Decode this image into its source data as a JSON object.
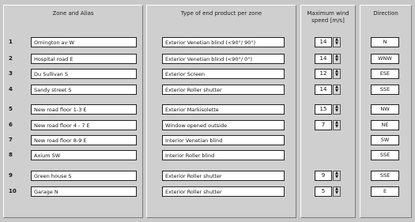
{
  "headers": {
    "zone": "Zone and Alias",
    "product": "Type of end product per zone",
    "wind_line1": "Maximum wind",
    "wind_line2": "speed [m/s]",
    "direction": "Direction"
  },
  "rows": [
    {
      "num": "1",
      "zone": "Ornington av W",
      "product": "Exterior Venetian blind (<90°/ 90°)",
      "wind": "14",
      "dir": "N"
    },
    {
      "num": "2",
      "zone": "Hospital road E",
      "product": "Exterior Venetian blind (<90°/ 0°)",
      "wind": "14",
      "dir": "WNW"
    },
    {
      "num": "3",
      "zone": "Du Sullivan S",
      "product": "Exterior Screen",
      "wind": "12",
      "dir": "ESE"
    },
    {
      "num": "4",
      "zone": "Sandy street S",
      "product": "Exterior Roller shutter",
      "wind": "14",
      "dir": "SSE"
    },
    {
      "num": "5",
      "zone": "New road floor 1-3 E",
      "product": "Exterior Markisolette",
      "wind": "15",
      "dir": "NW"
    },
    {
      "num": "6",
      "zone": "New road floor 4 - 7 E",
      "product": "Window opened outside",
      "wind": "7",
      "dir": "NE"
    },
    {
      "num": "7",
      "zone": "New road floor 8-9 E",
      "product": "Interior Venetian blind",
      "wind": "",
      "dir": "SW"
    },
    {
      "num": "8",
      "zone": "Axium SW",
      "product": "Interior Roller blind",
      "wind": "",
      "dir": "SSE"
    },
    {
      "num": "9",
      "zone": "Green house S",
      "product": "Exterior Roller shutter",
      "wind": "9",
      "dir": "SSE"
    },
    {
      "num": "10",
      "zone": "Garage N",
      "product": "Exterior Roller shutter",
      "wind": "5",
      "dir": "E"
    }
  ],
  "icons": {
    "dropdown": "chevron-down-icon",
    "spinner": "up-down-arrows-icon"
  }
}
